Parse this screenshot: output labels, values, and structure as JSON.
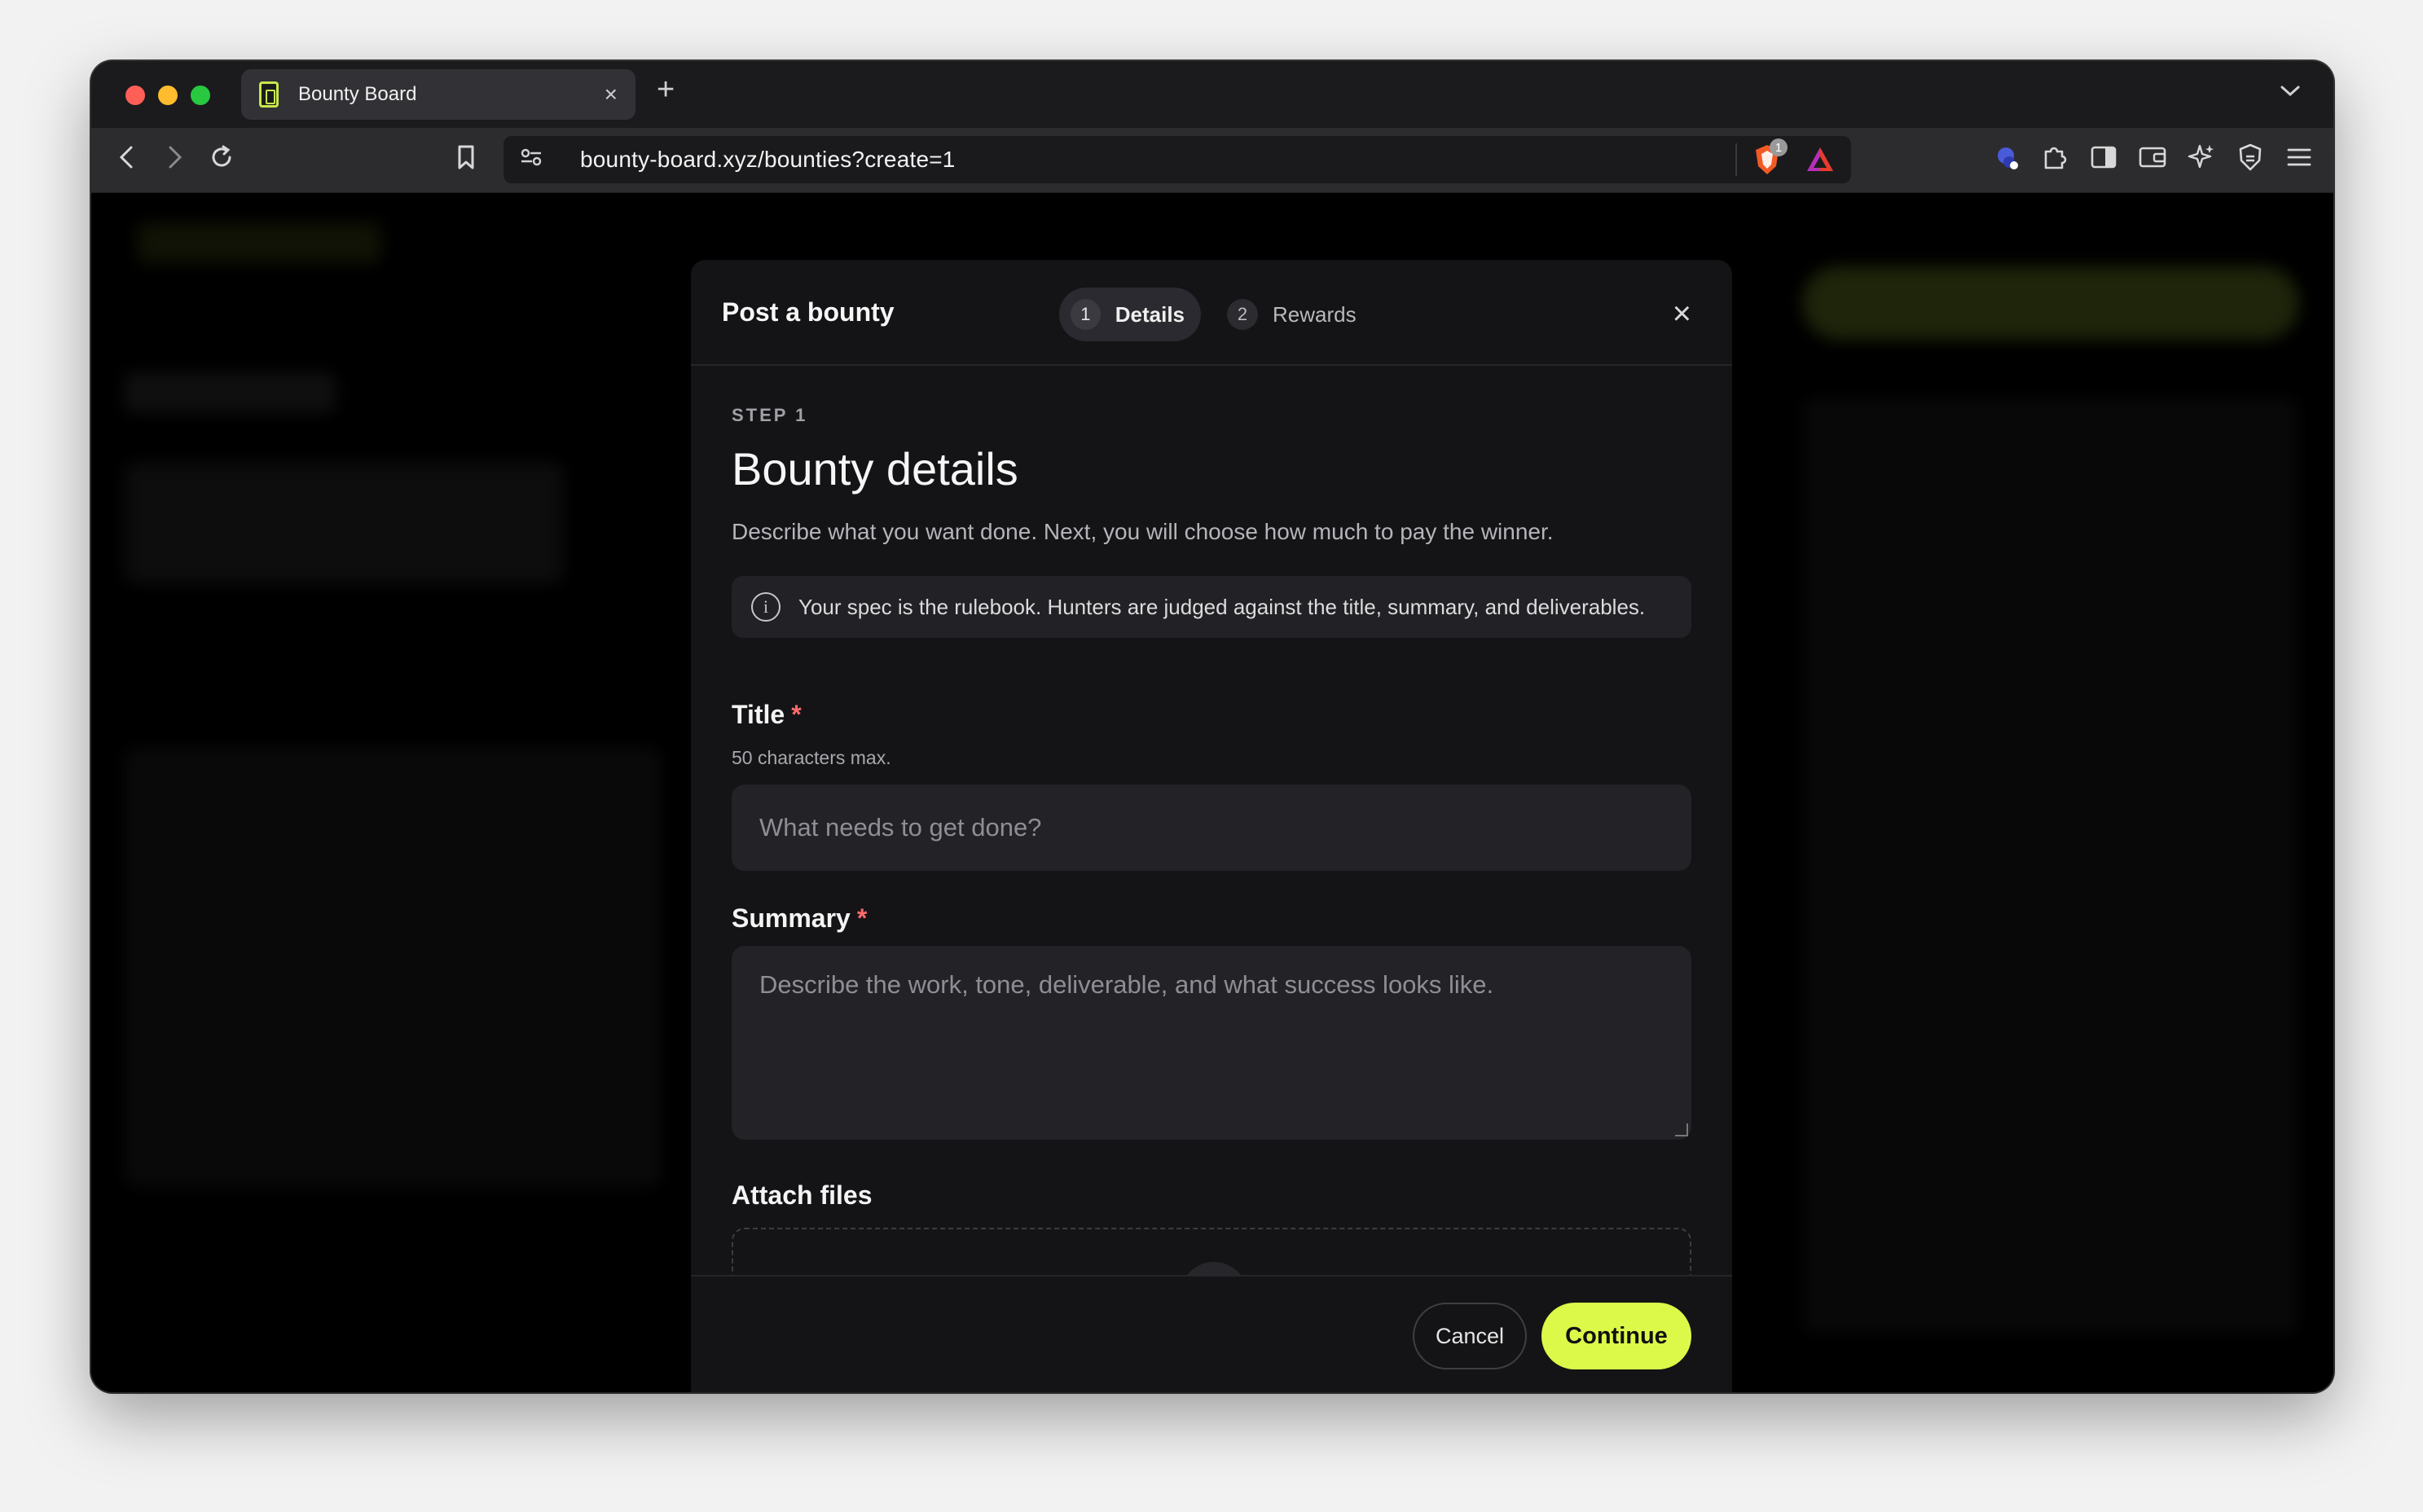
{
  "browser": {
    "tab_title": "Bounty Board",
    "tab_close": "×",
    "new_tab": "+",
    "url": "bounty-board.xyz/bounties?create=1",
    "shields_count": "1",
    "icons": [
      "back-icon",
      "forward-icon",
      "reload-icon",
      "bookmark-icon",
      "site-settings-icon",
      "brave-shields-icon",
      "brave-rewards-icon",
      "vpn-icon",
      "extensions-icon",
      "sidebar-icon",
      "wallet-icon",
      "leo-icon",
      "privacy-icon",
      "menu-icon",
      "tab-list-icon"
    ]
  },
  "modal": {
    "title": "Post a bounty",
    "steps": [
      {
        "num": "1",
        "label": "Details",
        "active": true
      },
      {
        "num": "2",
        "label": "Rewards",
        "active": false
      }
    ],
    "close": "×",
    "kicker": "STEP 1",
    "heading": "Bounty details",
    "description": "Describe what you want done. Next, you will choose how much to pay the winner.",
    "info": "Your spec is the rulebook. Hunters are judged against the title, summary, and deliverables.",
    "title_field": {
      "label": "Title",
      "required": "*",
      "hint": "50 characters max.",
      "placeholder": "What needs to get done?"
    },
    "summary_field": {
      "label": "Summary",
      "required": "*",
      "placeholder": "Describe the work, tone, deliverable, and what success looks like."
    },
    "attach_label": "Attach files",
    "cancel": "Cancel",
    "continue": "Continue"
  },
  "colors": {
    "accent": "#dcf94a",
    "required": "#ff6b6b",
    "modal_bg": "#141416"
  }
}
